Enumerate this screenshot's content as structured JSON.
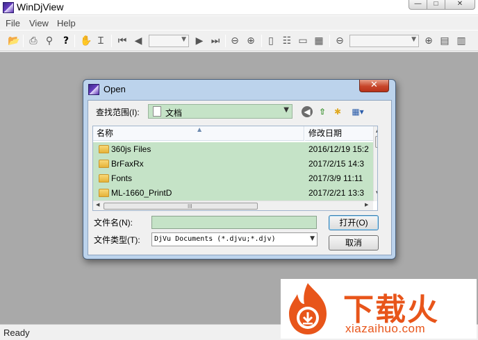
{
  "window": {
    "title": "WinDjView",
    "min_glyph": "—",
    "max_glyph": "□",
    "close_glyph": "✕"
  },
  "menu": {
    "items": [
      "File",
      "View",
      "Help"
    ]
  },
  "toolbar": {
    "icons": [
      "open-folder-icon",
      "print-icon",
      "find-icon",
      "help-icon",
      "hand-tool-icon",
      "text-select-icon",
      "first-page-icon",
      "previous-page-icon",
      "page-number-combo",
      "next-page-icon",
      "last-page-icon",
      "back-icon",
      "forward-icon",
      "single-page-icon",
      "continuous-icon",
      "facing-icon",
      "facing-continuous-icon",
      "zoom-out-icon",
      "zoom-combo",
      "zoom-in-icon",
      "fit-page-icon",
      "fit-width-icon"
    ],
    "glyphs": {
      "open": "📂",
      "print": "⎙",
      "find": "⚲",
      "help": "?",
      "hand": "✋",
      "text": "Ɪ",
      "first": "⏮",
      "prev": "◀",
      "next": "▶",
      "last": "⏭",
      "back": "⊖",
      "fwd": "⊕",
      "single": "▯",
      "cont": "☷",
      "facing": "▭",
      "facing_cont": "▦",
      "zoom_out": "⊖",
      "zoom_in": "⊕",
      "fit_page": "▤",
      "fit_width": "▥",
      "dropdown": "▼"
    }
  },
  "status": {
    "text": "Ready"
  },
  "dialog": {
    "title": "Open",
    "close_glyph": "✕",
    "look_in_label": "查找范围(I):",
    "look_in_value": "文档",
    "dropdown_glyph": "▼",
    "nav_glyphs": {
      "back": "◀",
      "up": "⇧",
      "new_folder": "✱",
      "view": "▦▾"
    },
    "columns": {
      "name": "名称",
      "date": "修改日期"
    },
    "sort_glyph": "▲",
    "files": [
      {
        "name": "360js Files",
        "date": "2016/12/19 15:2"
      },
      {
        "name": "BrFaxRx",
        "date": "2017/2/15 14:3"
      },
      {
        "name": "Fonts",
        "date": "2017/3/9 11:11"
      },
      {
        "name": "ML-1660_PrintD",
        "date": "2017/2/21 13:3"
      }
    ],
    "scroll_glyphs": {
      "up": "▲",
      "down": "▼",
      "left": "◀",
      "right": "▶",
      "grip": "III"
    },
    "filename_label": "文件名(N):",
    "filename_value": "",
    "filetype_label": "文件类型(T):",
    "filetype_value": "DjVu Documents (*.djvu;*.djv)",
    "open_button": "打开(O)",
    "cancel_button": "取消"
  },
  "watermark": {
    "logo_text": "下载火",
    "url": "xiazaihuo.com"
  },
  "colors": {
    "workspace": "#a9a9a9",
    "selection": "#c5e3c7",
    "dialog_frame": "#bcd3ec",
    "close_red": "#c7462a",
    "watermark": "#e8551a"
  }
}
